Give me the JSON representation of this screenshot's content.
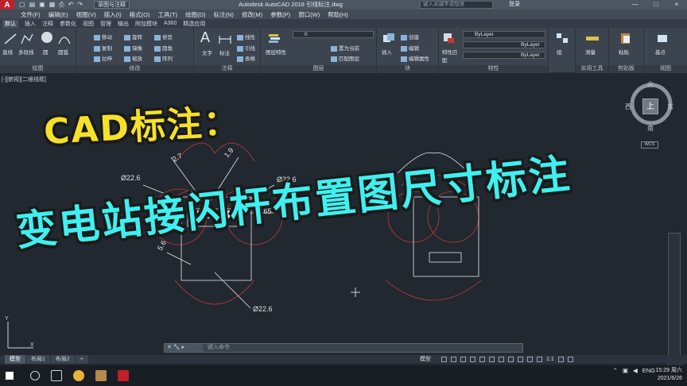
{
  "titlebar": {
    "app_icon_letter": "A",
    "workspace": "草图与注释",
    "title": "Autodesk AutoCAD 2018    引线标注.dwg",
    "search_placeholder": "键入关键字或短语",
    "signin": "登录",
    "window_buttons": [
      "—",
      "□",
      "×"
    ]
  },
  "menubar": [
    "文件(F)",
    "编辑(E)",
    "视图(V)",
    "插入(I)",
    "格式(O)",
    "工具(T)",
    "绘图(D)",
    "标注(N)",
    "修改(M)",
    "参数(P)",
    "窗口(W)",
    "帮助(H)"
  ],
  "ribbon_tabs": [
    "默认",
    "插入",
    "注释",
    "参数化",
    "视图",
    "管理",
    "输出",
    "附加模块",
    "A360",
    "精选应用"
  ],
  "ribbon": {
    "draw": {
      "label": "绘图",
      "tools": [
        "直线",
        "多段线",
        "圆",
        "圆弧"
      ]
    },
    "modify": {
      "label": "修改",
      "tools": [
        "移动",
        "旋转",
        "修剪",
        "复制",
        "镜像",
        "圆角",
        "拉伸",
        "缩放",
        "阵列"
      ]
    },
    "annotation": {
      "label": "注释",
      "tools": [
        "文字",
        "标注",
        "线性",
        "引线",
        "表格"
      ]
    },
    "layers": {
      "label": "图层",
      "tools": [
        "图层特性",
        "置为当前",
        "匹配图层"
      ],
      "current_layer": "0"
    },
    "block": {
      "label": "块",
      "tools": [
        "插入",
        "创建",
        "编辑",
        "编辑属性"
      ]
    },
    "properties": {
      "label": "特性",
      "tools": [
        "特性匹配"
      ],
      "values": [
        "ByLayer",
        "ByLayer",
        "ByLayer"
      ]
    },
    "groups": {
      "label": "",
      "tools": [
        "组"
      ]
    },
    "utilities": {
      "label": "实用工具",
      "tools": [
        "测量"
      ]
    },
    "clipboard": {
      "label": "剪贴板",
      "tools": [
        "粘贴"
      ]
    },
    "view": {
      "label": "视图",
      "tools": [
        "基点"
      ]
    }
  },
  "canvas": {
    "view_label": "[-][俯视][二维线框]",
    "viewcube": {
      "top": "上",
      "n": "北",
      "s": "南",
      "e": "东",
      "w": "西",
      "wcs": "WCS"
    },
    "dimensions": [
      "2.7",
      "1.9",
      "Ø22.6",
      "Ø22.6",
      "1.65",
      "5.6",
      "Ø22.6"
    ],
    "overlay_line1": "CAD标注：",
    "overlay_line2": "变电站接闪杆布置图尺寸标注",
    "ucs_x": "X",
    "ucs_y": "Y"
  },
  "command": {
    "placeholder": "键入命令"
  },
  "layout_tabs": [
    "模型",
    "布局1",
    "布局2",
    "+"
  ],
  "status": {
    "mode": "模型",
    "scale": "1:1"
  },
  "taskbar": {
    "lang": "ENG",
    "time": "15:29 周六",
    "date": "2021/6/26"
  }
}
